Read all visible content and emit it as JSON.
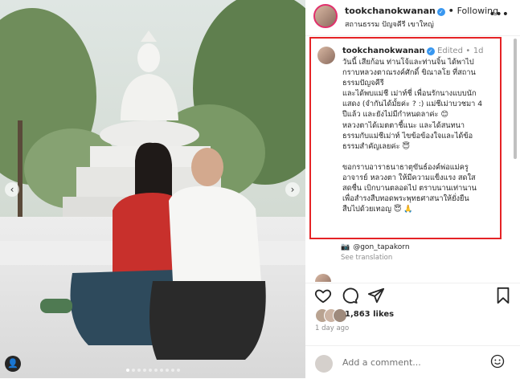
{
  "header": {
    "username": "tookchanokwanan",
    "separator": "•",
    "follow_status": "Following",
    "location": "สถานธรรม ปัญจคีรี เขาใหญ่"
  },
  "caption": {
    "username": "tookchanokwanan",
    "edited": "Edited",
    "dot": "•",
    "time": "1d",
    "text": "วันนี้ เสียก้อน ท่านโจ้และท่านจิ้น ได้พาไป\nกราบหลวงตาณรงค์ศักดิ์ ขิณาลโย ที่สถาน\nธรรมปัญจคีรี\nและได้พบแม่ชี เม่าท์ชี่ เพื่อนรักนางแบบนัก\nแสดง (จำกันได้มั้ยค่ะ ? :) แม่ชีเม่าบวชมา 4\nปีแล้ว และยังไม่มีกำหนดลาค่ะ 😊\nหลวงตาได้เมตตาชี้แนะ และได้สนทนา\nธรรมกับแม่ชีเม่าท์ ไขข้อข้องใจและได้ข้อ\nธรรมสำคัญเลยค่ะ 😇\n\nขอกราบอาราธนาธาตุขันธ์องค์พ่อแม่ครู\nอาจารย์ หลวงตา ให้มีความแข็งแรง สดใส\nสดชื่น เบิกบานตลอดไป ตราบนานเท่านาน\nเพื่อสำรงสืบทอดพระพุทธศาสนาให้ยั่งยืน\nสืบไปด้วยเทอญ 😇 🙏"
  },
  "photo_credit": {
    "icon": "📷",
    "handle": "@gon_tapakorn"
  },
  "see_translation": "See translation",
  "likes": "1,863 likes",
  "date": "1 day ago",
  "comment_placeholder": "Add a comment...",
  "colors": {
    "highlight_border": "#e52326",
    "verified": "#3897f0",
    "muted": "#8e8e8e"
  },
  "icons": [
    "heart-icon",
    "comment-icon",
    "share-icon",
    "bookmark-icon",
    "more-icon",
    "emoji-icon",
    "verified-icon",
    "user-tag-icon"
  ]
}
